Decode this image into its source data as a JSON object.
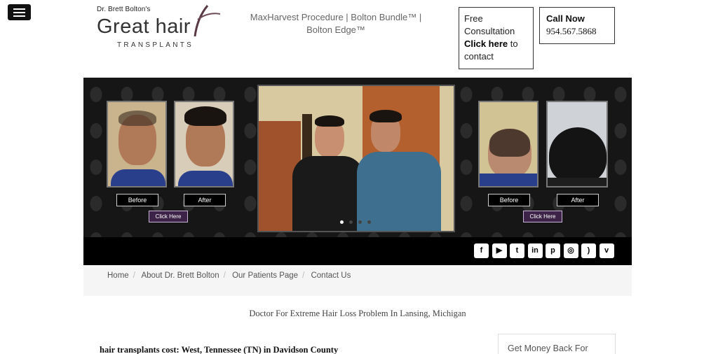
{
  "logo": {
    "top_line": "Dr. Brett Bolton's",
    "main": "Great hair",
    "sub": "TRANSPLANTS"
  },
  "tagline": "MaxHarvest Procedure | Bolton Bundle™ | Bolton Edge™",
  "free_consultation": {
    "line1": "Free",
    "line2": "Consultation",
    "link": "Click here",
    "rest": "to contact"
  },
  "call": {
    "title": "Call Now",
    "phone": "954.567.5868"
  },
  "banner": {
    "left": {
      "before": "Before",
      "after": "After",
      "cta": "Click Here"
    },
    "right": {
      "before": "Before",
      "after": "After",
      "cta": "Click Here"
    },
    "slides": 4,
    "active_slide": 1
  },
  "social": [
    {
      "icon": "facebook-icon",
      "glyph": "f"
    },
    {
      "icon": "youtube-icon",
      "glyph": "▶"
    },
    {
      "icon": "twitter-icon",
      "glyph": "t"
    },
    {
      "icon": "linkedin-icon",
      "glyph": "in"
    },
    {
      "icon": "pinterest-icon",
      "glyph": "p"
    },
    {
      "icon": "instagram-icon",
      "glyph": "◎"
    },
    {
      "icon": "rss-icon",
      "glyph": ")"
    },
    {
      "icon": "vimeo-icon",
      "glyph": "v"
    }
  ],
  "breadcrumb": [
    "Home",
    "About Dr. Brett Bolton",
    "Our Patients Page",
    "Contact Us"
  ],
  "subtitle": "Doctor For Extreme Hair Loss Problem In Lansing, Michigan",
  "article_title": "hair transplants cost: West, Tennessee (TN) in Davidson County",
  "side_box": "Get Money Back For",
  "colors": {
    "banner_bg": "#161616",
    "cta_purple": "#3c2347",
    "breadcrumb_bg": "#f5f5f5"
  }
}
